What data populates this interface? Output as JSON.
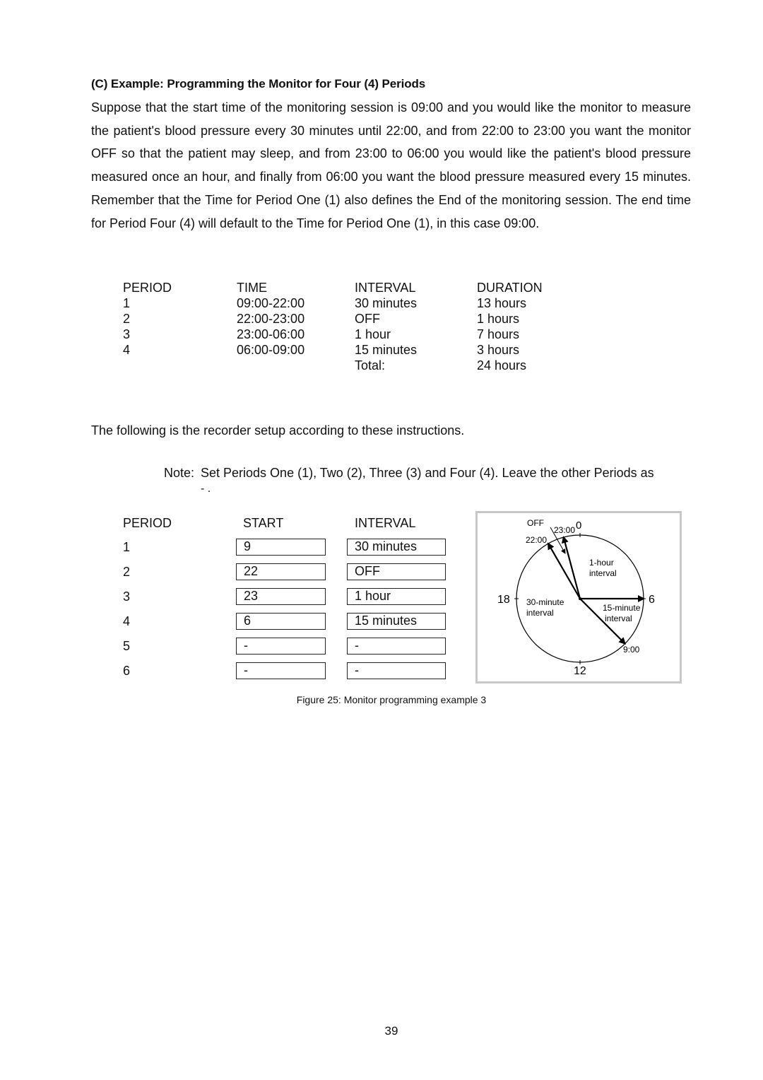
{
  "section": {
    "heading": "(C) Example: Programming the Monitor for Four (4) Periods",
    "paragraph": "Suppose that the start time of the monitoring session is 09:00 and you would like the monitor to measure the patient's blood pressure every 30 minutes until 22:00, and from 22:00 to 23:00 you want the monitor OFF so that the patient may sleep, and from 23:00 to 06:00 you would like the patient's blood pressure measured once an hour, and finally from 06:00 you want the blood pressure measured every 15 minutes. Remember that the Time for Period One (1) also defines the End of the monitoring session. The end time for Period Four (4) will default to the Time for Period One (1), in this case 09:00."
  },
  "schedule_table": {
    "headers": [
      "PERIOD",
      "TIME",
      "INTERVAL",
      "DURATION"
    ],
    "rows": [
      {
        "period": "1",
        "time": "09:00-22:00",
        "interval": "30 minutes",
        "duration": "13 hours"
      },
      {
        "period": "2",
        "time": "22:00-23:00",
        "interval": "OFF",
        "duration": "1 hours"
      },
      {
        "period": "3",
        "time": "23:00-06:00",
        "interval": "1 hour",
        "duration": "7 hours"
      },
      {
        "period": "4",
        "time": "06:00-09:00",
        "interval": "15 minutes",
        "duration": "3 hours"
      }
    ],
    "total_label": "Total:",
    "total_value": "24 hours"
  },
  "following_text": "The following is the recorder setup according to these instructions.",
  "note": {
    "label": "Note",
    "sep": ":",
    "text": "Set Periods One (1), Two (2), Three (3) and Four (4). Leave the other Periods as",
    "text2": "- ."
  },
  "setup_table": {
    "headers": [
      "PERIOD",
      "START",
      "INTERVAL"
    ],
    "rows": [
      {
        "period": "1",
        "start": "9",
        "interval": "30 minutes"
      },
      {
        "period": "2",
        "start": "22",
        "interval": "OFF"
      },
      {
        "period": "3",
        "start": "23",
        "interval": "1 hour"
      },
      {
        "period": "4",
        "start": "6",
        "interval": "15 minutes"
      },
      {
        "period": "5",
        "start": "-",
        "interval": "-"
      },
      {
        "period": "6",
        "start": "-",
        "interval": "-"
      }
    ]
  },
  "clock_diagram": {
    "labels": {
      "top": "0",
      "right": "6",
      "bottom": "12",
      "left": "18",
      "off": "OFF",
      "t2300": "23:00",
      "t2200": "22:00",
      "t900": "9:00",
      "one_hour_1": "1-hour",
      "one_hour_2": "interval",
      "thirty_min_1": "30-minute",
      "thirty_min_2": "interval",
      "fifteen_min_1": "15-minute",
      "fifteen_min_2": "interval"
    },
    "hands_hours": [
      22,
      23,
      6,
      9
    ]
  },
  "caption": "Figure 25: Monitor programming example 3",
  "page_number": "39"
}
